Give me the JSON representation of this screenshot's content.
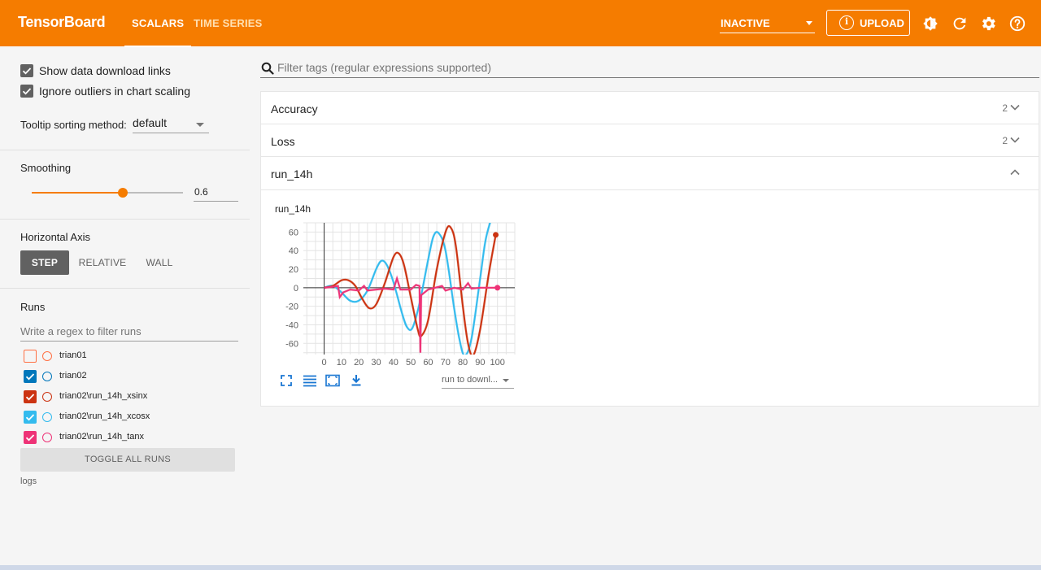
{
  "header": {
    "brand": "TensorBoard",
    "tabs": [
      {
        "label": "SCALARS",
        "active": true
      },
      {
        "label": "TIME SERIES",
        "active": false
      }
    ],
    "run_select": "INACTIVE",
    "upload_label": "UPLOAD",
    "icons": [
      "brightness-icon",
      "refresh-icon",
      "settings-icon",
      "help-icon"
    ]
  },
  "sidebar": {
    "options": [
      {
        "label": "Show data download links",
        "checked": true
      },
      {
        "label": "Ignore outliers in chart scaling",
        "checked": true
      }
    ],
    "tooltip_label": "Tooltip sorting method:",
    "tooltip_value": "default",
    "smoothing_label": "Smoothing",
    "smoothing_value": "0.6",
    "smoothing_fraction": 0.6,
    "horizontal_axis_label": "Horizontal Axis",
    "axis_options": [
      "STEP",
      "RELATIVE",
      "WALL"
    ],
    "axis_selected": "STEP",
    "runs_label": "Runs",
    "regex_placeholder": "Write a regex to filter runs",
    "runs": [
      {
        "name": "trian01",
        "checked": false,
        "color": "#ff7043"
      },
      {
        "name": "trian02",
        "checked": true,
        "color": "#0077bb"
      },
      {
        "name": "trian02\\run_14h_xsinx",
        "checked": true,
        "color": "#cc3311"
      },
      {
        "name": "trian02\\run_14h_xcosx",
        "checked": true,
        "color": "#33bbee"
      },
      {
        "name": "trian02\\run_14h_tanx",
        "checked": true,
        "color": "#ee3377"
      }
    ],
    "toggle_all_label": "TOGGLE ALL RUNS",
    "logdir": "logs"
  },
  "main": {
    "filter_placeholder": "Filter tags (regular expressions supported)",
    "categories": [
      {
        "title": "Accuracy",
        "count": "2",
        "expanded": false
      },
      {
        "title": "Loss",
        "count": "2",
        "expanded": false
      },
      {
        "title": "run_14h",
        "count": "",
        "expanded": true
      }
    ],
    "card_title": "run_14h",
    "run_download_label": "run to downl..."
  },
  "colors": {
    "accent": "#f57c00",
    "xsinx": "#cc3311",
    "xcosx": "#33bbee",
    "tanx": "#ee3377"
  },
  "chart_data": {
    "type": "line",
    "title": "run_14h",
    "x_ticks": [
      0,
      10,
      20,
      30,
      40,
      50,
      60,
      70,
      80,
      90,
      100
    ],
    "y_ticks": [
      60,
      40,
      20,
      0,
      -20,
      -40,
      -60
    ],
    "xlim": [
      -12,
      110
    ],
    "ylim": [
      -72,
      70
    ],
    "grid": true,
    "series": [
      {
        "name": "trian02\\run_14h_xcosx",
        "color": "#33bbee",
        "points": [
          [
            0,
            0
          ],
          [
            5,
            2
          ],
          [
            10,
            -5
          ],
          [
            15,
            -14
          ],
          [
            20,
            -14
          ],
          [
            25,
            -3
          ],
          [
            30,
            20
          ],
          [
            33,
            29
          ],
          [
            36,
            25
          ],
          [
            40,
            6
          ],
          [
            45,
            -28
          ],
          [
            48,
            -43
          ],
          [
            51,
            -43
          ],
          [
            55,
            -17
          ],
          [
            60,
            30
          ],
          [
            63,
            55
          ],
          [
            66,
            59
          ],
          [
            70,
            40
          ],
          [
            75,
            -22
          ],
          [
            78,
            -55
          ],
          [
            81,
            -73
          ],
          [
            85,
            -55
          ],
          [
            90,
            10
          ],
          [
            93,
            50
          ],
          [
            96,
            72
          ]
        ]
      },
      {
        "name": "trian02\\run_14h_xsinx",
        "color": "#cc3311",
        "points": [
          [
            0,
            0
          ],
          [
            5,
            2
          ],
          [
            10,
            8
          ],
          [
            14,
            8
          ],
          [
            18,
            2
          ],
          [
            22,
            -12
          ],
          [
            26,
            -22
          ],
          [
            30,
            -18
          ],
          [
            35,
            5
          ],
          [
            40,
            33
          ],
          [
            43,
            37
          ],
          [
            46,
            25
          ],
          [
            50,
            -10
          ],
          [
            54,
            -45
          ],
          [
            56,
            -52
          ],
          [
            60,
            -35
          ],
          [
            65,
            20
          ],
          [
            70,
            60
          ],
          [
            73,
            65
          ],
          [
            76,
            45
          ],
          [
            80,
            -20
          ],
          [
            83,
            -60
          ],
          [
            86,
            -73
          ],
          [
            90,
            -45
          ],
          [
            95,
            15
          ],
          [
            99,
            57
          ]
        ]
      },
      {
        "name": "trian02\\run_14h_tanx",
        "color": "#ee3377",
        "points": [
          [
            0,
            0
          ],
          [
            5,
            1
          ],
          [
            8,
            2
          ],
          [
            9,
            -10
          ],
          [
            11,
            -5
          ],
          [
            15,
            -2
          ],
          [
            20,
            -3
          ],
          [
            23,
            2
          ],
          [
            25,
            -3
          ],
          [
            30,
            -2
          ],
          [
            35,
            -1
          ],
          [
            40,
            -2
          ],
          [
            42,
            10
          ],
          [
            44,
            -2
          ],
          [
            50,
            -2
          ],
          [
            53,
            3
          ],
          [
            55,
            2
          ],
          [
            55.5,
            -70
          ],
          [
            56,
            -8
          ],
          [
            60,
            -2
          ],
          [
            64,
            0
          ],
          [
            68,
            2
          ],
          [
            70,
            -3
          ],
          [
            72,
            -2
          ],
          [
            75,
            0
          ],
          [
            80,
            -2
          ],
          [
            83,
            5
          ],
          [
            85,
            -1
          ],
          [
            90,
            0
          ],
          [
            95,
            0
          ],
          [
            100,
            0
          ]
        ]
      }
    ]
  }
}
